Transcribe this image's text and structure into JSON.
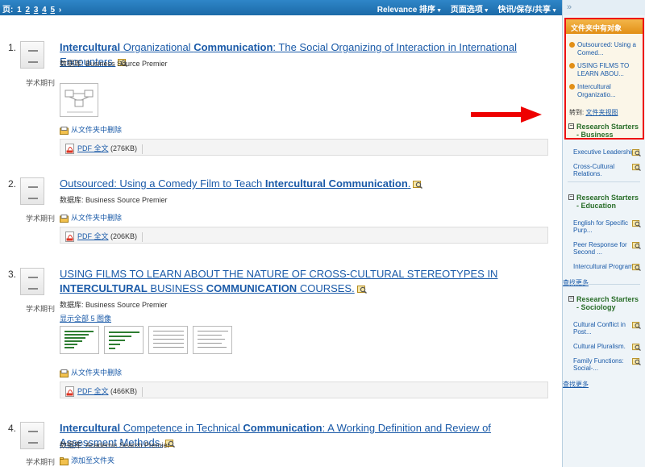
{
  "toolbar": {
    "page_label": "页:",
    "pages": [
      "1",
      "2",
      "3",
      "4",
      "5"
    ],
    "next": "›",
    "sort": "Relevance 排序",
    "page_options": "页面选项",
    "share": "快讯/保存/共享"
  },
  "results": [
    {
      "num": "1.",
      "type": "学术期刊",
      "title_parts": [
        {
          "t": "Intercultural",
          "b": true
        },
        {
          "t": " Organizational ",
          "b": false
        },
        {
          "t": "Communication",
          "b": true
        },
        {
          "t": ": The Social Organizing of Interaction in International Encounters.",
          "b": false
        }
      ],
      "db": "数据库: Business Source Premier",
      "folder_action": "从文件夹中删除",
      "pdf_label": "PDF 全文",
      "pdf_size": "(276KB)"
    },
    {
      "num": "2.",
      "type": "学术期刊",
      "title_parts": [
        {
          "t": "Outsourced: Using a Comedy Film to Teach ",
          "b": false
        },
        {
          "t": "Intercultural Communication",
          "b": true
        },
        {
          "t": ".",
          "b": false
        }
      ],
      "db": "数据库: Business Source Premier",
      "folder_action": "从文件夹中删除",
      "pdf_label": "PDF 全文",
      "pdf_size": "(206KB)"
    },
    {
      "num": "3.",
      "type": "学术期刊",
      "title_parts": [
        {
          "t": "USING FILMS TO LEARN ABOUT THE NATURE OF CROSS-CULTURAL STEREOTYPES IN ",
          "b": false
        },
        {
          "t": "INTERCULTURAL",
          "b": true
        },
        {
          "t": " BUSINESS ",
          "b": false
        },
        {
          "t": "COMMUNICATION",
          "b": true
        },
        {
          "t": " COURSES.",
          "b": false
        }
      ],
      "db": "数据库: Business Source Premier",
      "show_all": "显示全部 5 图像",
      "folder_action": "从文件夹中删除",
      "pdf_label": "PDF 全文",
      "pdf_size": "(466KB)"
    },
    {
      "num": "4.",
      "type": "学术期刊",
      "title_parts": [
        {
          "t": "Intercultural",
          "b": true
        },
        {
          "t": " Competence in Technical ",
          "b": false
        },
        {
          "t": "Communication",
          "b": true
        },
        {
          "t": ": A Working Definition and Review of Assessment Methods.",
          "b": false
        }
      ],
      "db": "数据库: Academic Search Premier",
      "folder_action": "添加至文件夹"
    }
  ],
  "sidebar": {
    "collapse": "»",
    "folder": {
      "title": "文件夹中有对象",
      "items": [
        "Outsourced: Using a Comed...",
        "USING FILMS TO LEARN ABOU...",
        "Intercultural Organizatio..."
      ],
      "goto_label": "转到:",
      "goto_link": "文件夹视图"
    },
    "research_starters": [
      {
        "title": "Research Starters - Business",
        "items": [
          "Executive Leadership.",
          "Cross-Cultural Relations."
        ],
        "more": ""
      },
      {
        "title": "Research Starters - Education",
        "items": [
          "English for Specific Purp...",
          "Peer Response for Second ...",
          "Intercultural Programs."
        ],
        "more": "查找更多"
      },
      {
        "title": "Research Starters - Sociology",
        "items": [
          "Cultural Conflict in Post...",
          "Cultural Pluralism.",
          "Family Functions: Social-..."
        ],
        "more": "查找更多"
      }
    ]
  }
}
